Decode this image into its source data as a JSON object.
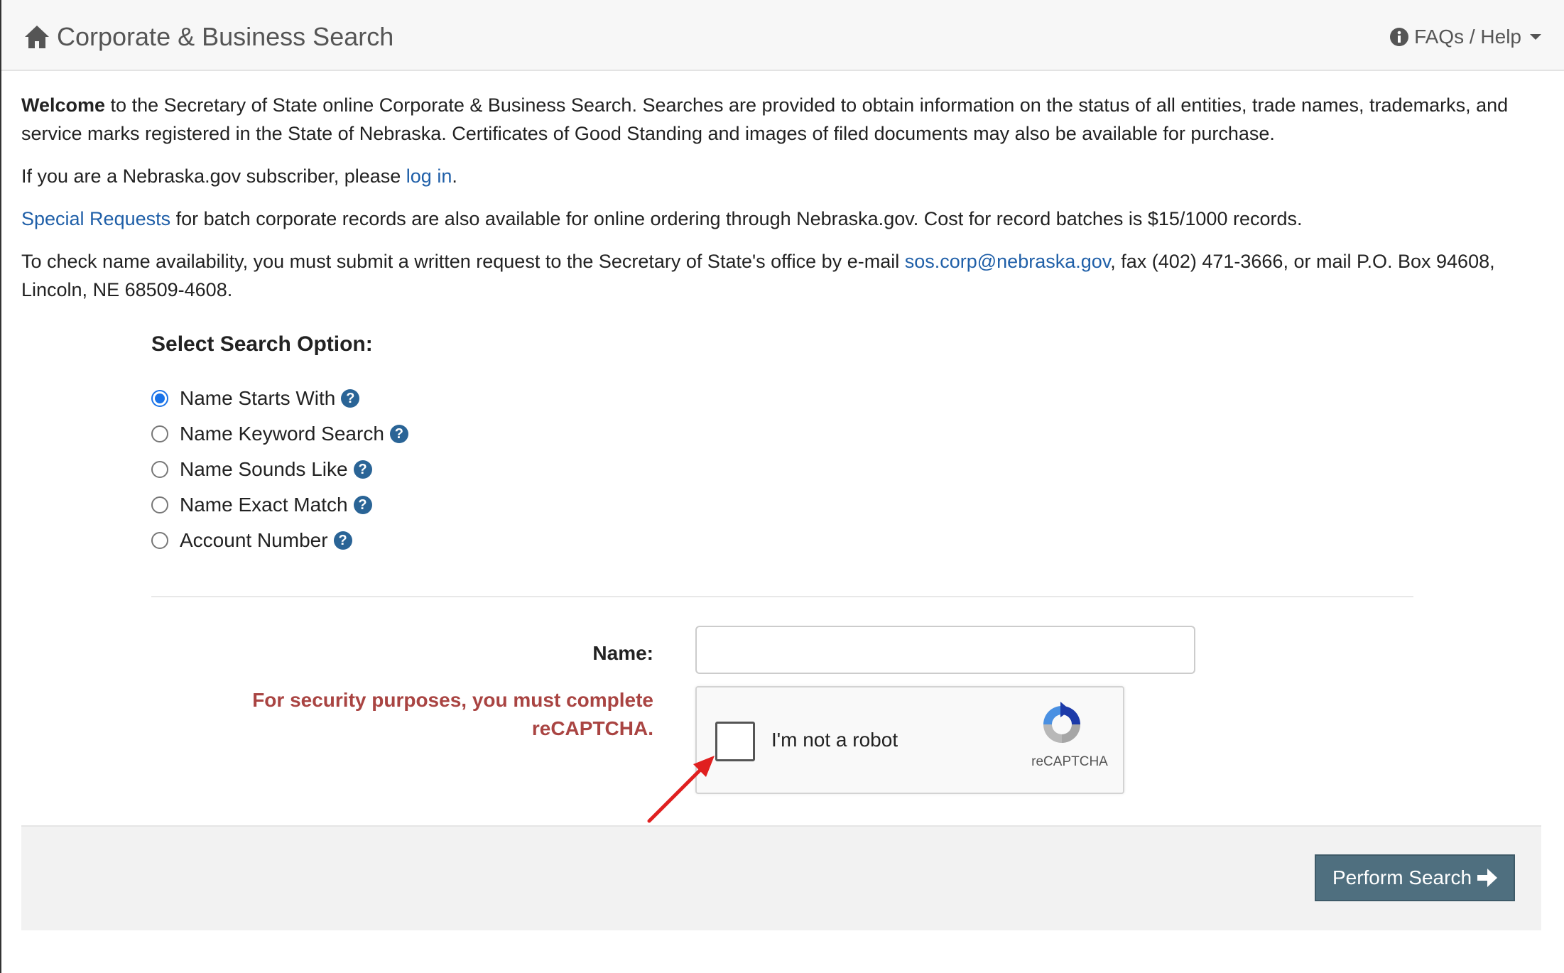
{
  "header": {
    "title": "Corporate & Business Search",
    "help_label": "FAQs / Help"
  },
  "intro": {
    "welcome_bold": "Welcome",
    "welcome_text": " to the Secretary of State online Corporate & Business Search. Searches are provided to obtain information on the status of all entities, trade names, trademarks, and service marks registered in the State of Nebraska. Certificates of Good Standing and images of filed documents may also be available for purchase.",
    "login_prefix": "If you are a Nebraska.gov subscriber, please ",
    "login_link": "log in",
    "login_suffix": ".",
    "special_link": "Special Requests",
    "special_text": " for batch corporate records are also available for online ordering through Nebraska.gov. Cost for record batches is $15/1000 records.",
    "name_check_prefix": "To check name availability, you must submit a written request to the Secretary of State's office by e-mail ",
    "email_link": "sos.corp@nebraska.gov",
    "name_check_suffix": ", fax (402) 471-3666, or mail P.O. Box 94608, Lincoln, NE 68509-4608."
  },
  "search": {
    "heading": "Select Search Option:",
    "options": [
      {
        "label": "Name Starts With",
        "checked": true
      },
      {
        "label": "Name Keyword Search",
        "checked": false
      },
      {
        "label": "Name Sounds Like",
        "checked": false
      },
      {
        "label": "Name Exact Match",
        "checked": false
      },
      {
        "label": "Account Number",
        "checked": false
      }
    ],
    "help_glyph": "?"
  },
  "form": {
    "name_label": "Name:",
    "name_value": "",
    "warning": "For security purposes, you must complete reCAPTCHA."
  },
  "captcha": {
    "label": "I'm not a robot",
    "brand": "reCAPTCHA"
  },
  "footer": {
    "button_label": "Perform Search"
  },
  "colors": {
    "link": "#1f5fa8",
    "warning": "#a94442",
    "button": "#4f6f7f",
    "radio_checked": "#1a73e8",
    "help_icon": "#2a6496",
    "annotation_arrow": "#e02020"
  },
  "icons": [
    "home-icon",
    "info-icon",
    "question-icon",
    "arrow-right-icon",
    "recaptcha-logo-icon"
  ]
}
